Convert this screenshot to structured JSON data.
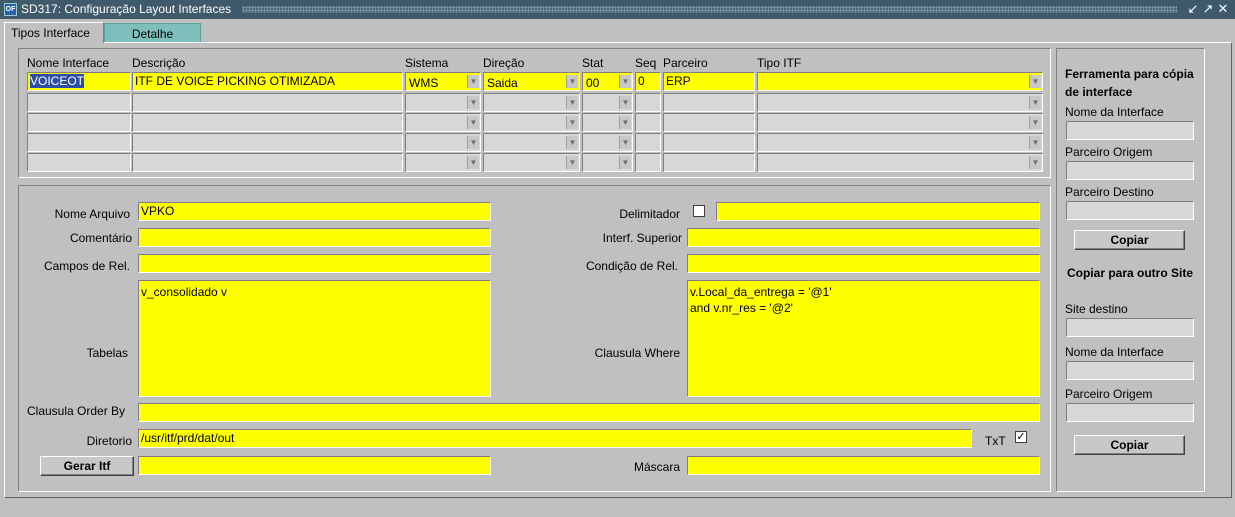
{
  "window": {
    "title": "SD317: Configuração Layout Interfaces",
    "icon_name": "oracle-forms-icon",
    "controls": [
      "minimize-icon",
      "maximize-icon",
      "close-icon"
    ]
  },
  "tabs": [
    {
      "label": "Tipos Interface",
      "active": true
    },
    {
      "label": "Detalhe",
      "active": false
    }
  ],
  "grid": {
    "headers": {
      "nome_interface": "Nome Interface",
      "descricao": "Descrição",
      "sistema": "Sistema",
      "direcao": "Direção",
      "stat": "Stat",
      "seq": "Seq",
      "parceiro": "Parceiro",
      "tipo_itf": "Tipo ITF"
    },
    "row1": {
      "nome_interface": "VOICEOT",
      "descricao": "ITF DE VOICE PICKING OTIMIZADA",
      "sistema": "WMS",
      "direcao": "Saida",
      "stat": "00",
      "seq": "0",
      "parceiro": "ERP",
      "tipo_itf": ""
    },
    "empty_rows": 4
  },
  "detail": {
    "nome_arquivo_label": "Nome Arquivo",
    "nome_arquivo": "VPKO",
    "comentario_label": "Comentário",
    "comentario": "",
    "campos_rel_label": "Campos de Rel.",
    "campos_rel": "",
    "tabelas_label": "Tabelas",
    "tabelas": "v_consolidado v",
    "clausula_order_label": "Clausula Order By",
    "clausula_order": "",
    "diretorio_label": "Diretorio",
    "diretorio": "/usr/itf/prd/dat/out",
    "gerar_itf_label": "Gerar Itf",
    "gerar_itf_value": "",
    "delimitador_label": "Delimitador",
    "delimitador_checked": false,
    "delimitador": "",
    "interf_superior_label": "Interf. Superior",
    "interf_superior": "",
    "condicao_rel_label": "Condição de Rel.",
    "condicao_rel": "",
    "clausula_where_label": "Clausula Where",
    "clausula_where": "v.Local_da_entrega = '@1'\nand v.nr_res = '@2'",
    "txt_label": "TxT",
    "txt_checked": true,
    "mascara_label": "Máscara",
    "mascara": ""
  },
  "tools": {
    "copy_title": "Ferramenta para cópia de interface",
    "nome_interface_label": "Nome da Interface",
    "parceiro_origem_label": "Parceiro Origem",
    "parceiro_destino_label": "Parceiro Destino",
    "copiar_label": "Copiar",
    "site_title": "Copiar para outro Site",
    "site_destino_label": "Site destino",
    "nome_interface2_label": "Nome da Interface",
    "parceiro_origem2_label": "Parceiro Origem",
    "copiar2_label": "Copiar"
  },
  "colors": {
    "titlebar": "#3e5a6b",
    "required_field": "#ffff00",
    "inactive_tab": "#7dbfbb",
    "selection": "#2b4ea8"
  }
}
